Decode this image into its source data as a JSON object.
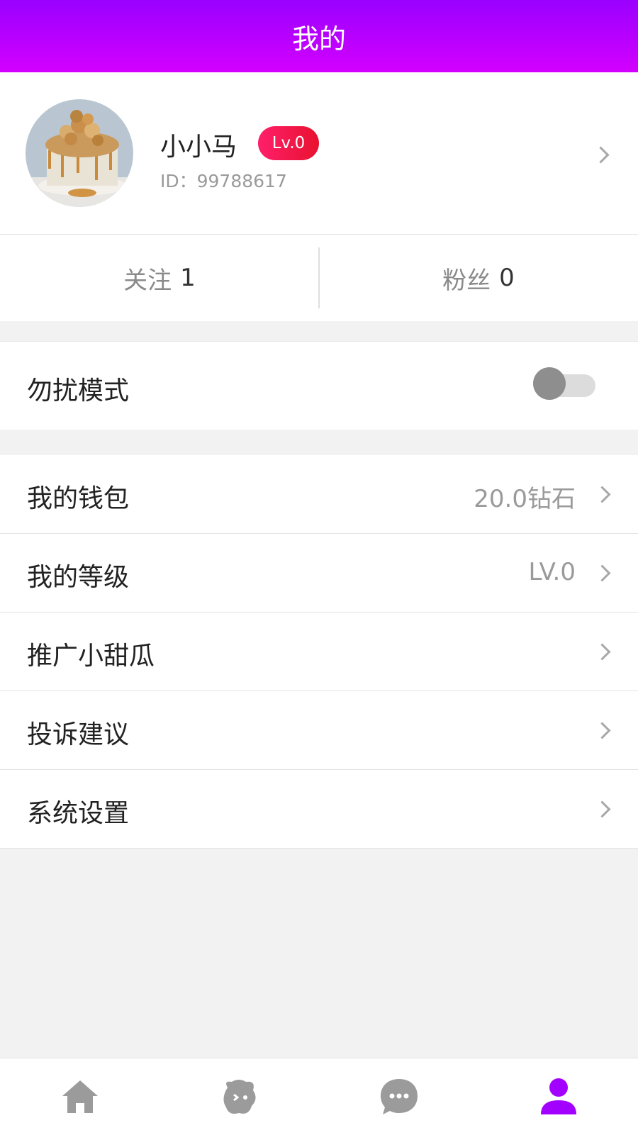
{
  "header": {
    "title": "我的"
  },
  "profile": {
    "name": "小小马",
    "level_badge": "Lv.0",
    "user_id": "ID：99788617"
  },
  "stats": {
    "following_label": "关注",
    "following_value": "1",
    "fans_label": "粉丝",
    "fans_value": "0"
  },
  "dnd": {
    "label": "勿扰模式",
    "enabled": false
  },
  "menu": [
    {
      "label": "我的钱包",
      "value": "20.0钻石"
    },
    {
      "label": "我的等级",
      "value": "LV.0"
    },
    {
      "label": "推广小甜瓜",
      "value": ""
    },
    {
      "label": "投诉建议",
      "value": ""
    },
    {
      "label": "系统设置",
      "value": ""
    }
  ],
  "tabbar": {
    "items": [
      {
        "icon": "home-icon"
      },
      {
        "icon": "discover-icon"
      },
      {
        "icon": "message-icon"
      },
      {
        "icon": "profile-icon",
        "active": true
      }
    ],
    "active_color": "#a200ff",
    "inactive_color": "#9b9b9b"
  },
  "colors": {
    "header_gradient_start": "#9a00ff",
    "header_gradient_end": "#d300ff",
    "badge": "#f0184e"
  }
}
